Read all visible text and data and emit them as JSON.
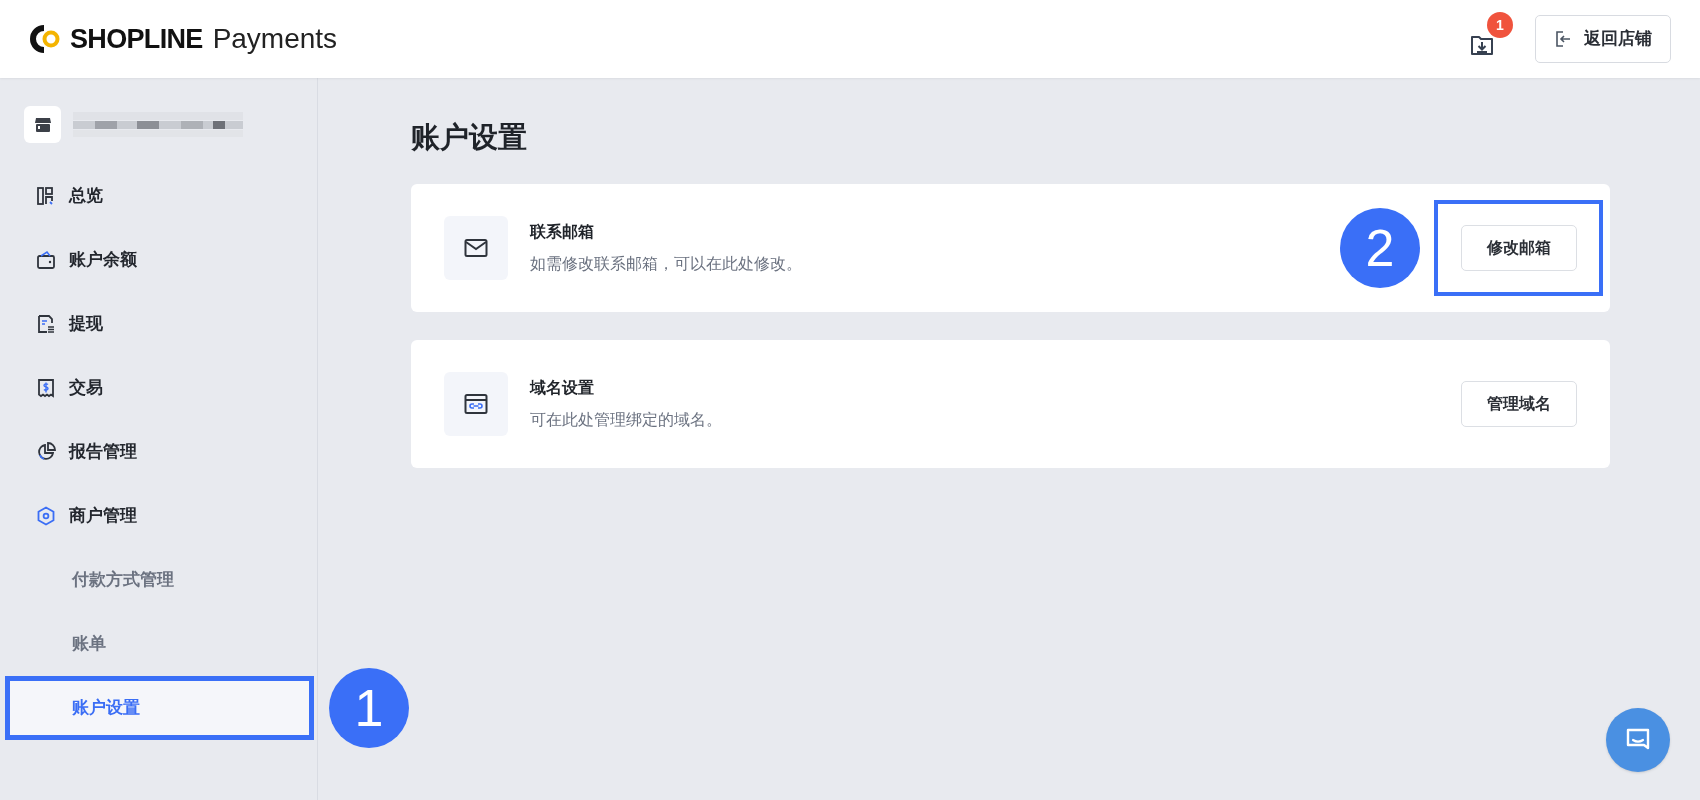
{
  "header": {
    "logo": {
      "brand": "SHOPLINE",
      "product": "Payments"
    },
    "downloads": {
      "badge": "1"
    },
    "back_button": {
      "label": "返回店铺"
    }
  },
  "sidebar": {
    "items": [
      {
        "label": "总览",
        "kind": "overview",
        "selected": false
      },
      {
        "label": "账户余额",
        "kind": "wallet",
        "selected": false
      },
      {
        "label": "提现",
        "kind": "withdraw",
        "selected": false
      },
      {
        "label": "交易",
        "kind": "transaction",
        "selected": false
      },
      {
        "label": "报告管理",
        "kind": "report",
        "selected": false
      },
      {
        "label": "商户管理",
        "kind": "merchant",
        "selected": false,
        "children": [
          {
            "label": "付款方式管理",
            "selected": false
          },
          {
            "label": "账单",
            "selected": false
          },
          {
            "label": "账户设置",
            "selected": true,
            "callout": "1"
          }
        ]
      }
    ]
  },
  "page": {
    "title": "账户设置",
    "cards": [
      {
        "kind": "mail",
        "title": "联系邮箱",
        "description": "如需修改联系邮箱，可以在此处修改。",
        "button": "修改邮箱",
        "callout": "2"
      },
      {
        "kind": "domain",
        "title": "域名设置",
        "description": "可在此处管理绑定的域名。",
        "button": "管理域名"
      }
    ]
  }
}
